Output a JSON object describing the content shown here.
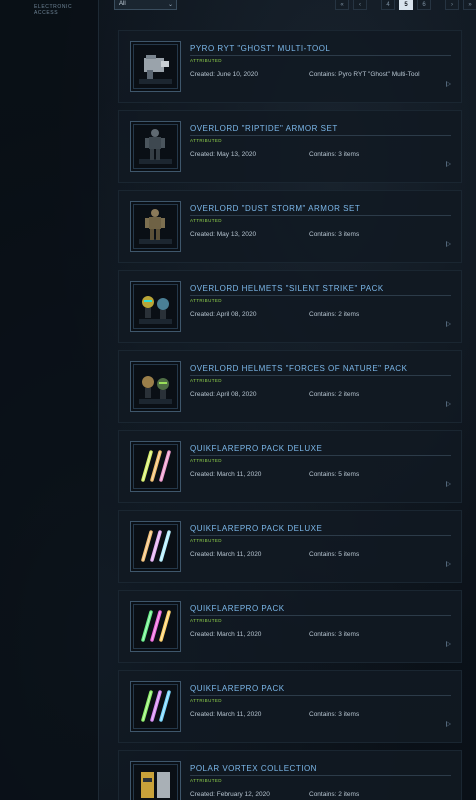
{
  "sidebar": {
    "label": "ELECTRONIC ACCESS"
  },
  "filter": {
    "value": "All",
    "icon": "chevron-down-icon"
  },
  "pagination": {
    "first": "«",
    "prev": "‹",
    "pages": [
      "4",
      "5",
      "6"
    ],
    "current": "5",
    "next": "›",
    "last": "»"
  },
  "items": [
    {
      "title": "PYRO RYT \"GHOST\" MULTI-TOOL",
      "tag": "ATTRIBUTED",
      "created": "Created: June 10, 2020",
      "contains": "Contains: Pyro RYT \"Ghost\" Multi-Tool",
      "thumb": "tool"
    },
    {
      "title": "OVERLORD \"RIPTIDE\" ARMOR SET",
      "tag": "ATTRIBUTED",
      "created": "Created: May 13, 2020",
      "contains": "Contains: 3 items",
      "thumb": "armor-dark"
    },
    {
      "title": "OVERLORD \"DUST STORM\" ARMOR SET",
      "tag": "ATTRIBUTED",
      "created": "Created: May 13, 2020",
      "contains": "Contains: 3 items",
      "thumb": "armor-tan"
    },
    {
      "title": "OVERLORD HELMETS \"SILENT STRIKE\" PACK",
      "tag": "ATTRIBUTED",
      "created": "Created: April 08, 2020",
      "contains": "Contains: 2 items",
      "thumb": "helmets-yellow"
    },
    {
      "title": "OVERLORD HELMETS \"FORCES OF NATURE\" PACK",
      "tag": "ATTRIBUTED",
      "created": "Created: April 08, 2020",
      "contains": "Contains: 2 items",
      "thumb": "helmets-green"
    },
    {
      "title": "QUIKFLAREPRO PACK DELUXE",
      "tag": "ATTRIBUTED",
      "created": "Created: March 11, 2020",
      "contains": "Contains: 5 items",
      "thumb": "flares-warm"
    },
    {
      "title": "QUIKFLAREPRO PACK DELUXE",
      "tag": "ATTRIBUTED",
      "created": "Created: March 11, 2020",
      "contains": "Contains: 5 items",
      "thumb": "flares-pastel"
    },
    {
      "title": "QUIKFLAREPRO PACK",
      "tag": "ATTRIBUTED",
      "created": "Created: March 11, 2020",
      "contains": "Contains: 3 items",
      "thumb": "flares-rgb"
    },
    {
      "title": "QUIKFLAREPRO PACK",
      "tag": "ATTRIBUTED",
      "created": "Created: March 11, 2020",
      "contains": "Contains: 3 items",
      "thumb": "flares-cool"
    },
    {
      "title": "POLAR VORTEX COLLECTION",
      "tag": "ATTRIBUTED",
      "created": "Created: February 12, 2020",
      "contains": "Contains: 2 items",
      "thumb": "polar"
    }
  ],
  "colors": {
    "title": "#7cb8ea",
    "tag": "#8fd04c",
    "active_page_bg": "#d9e4ee"
  }
}
